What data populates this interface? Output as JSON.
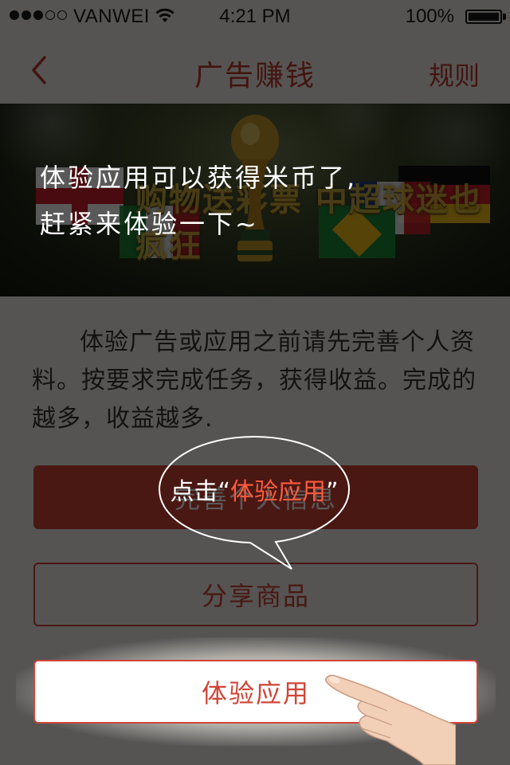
{
  "status_bar": {
    "carrier": "VANWEI",
    "time": "4:21 PM",
    "battery_percent": "100%",
    "battery_level": 1.0,
    "signal_icon": "signal-dots-icon",
    "wifi_icon": "wifi-icon"
  },
  "nav": {
    "title": "广告赚钱",
    "right_label": "规则",
    "back_icon": "chevron-left-icon"
  },
  "banner": {
    "slogan": "购物送彩票 中超球迷也疯狂"
  },
  "guide": {
    "line1": "体验应用可以获得米币了,",
    "line2": "赶紧来体验一下~",
    "bubble_prefix": "点击",
    "bubble_quote_open": "“",
    "bubble_highlight": "体验应用",
    "bubble_quote_close": "”"
  },
  "description": "体验广告或应用之前请先完善个人资料。按要求完成任务，获得收益。完成的越多，收益越多.",
  "buttons": {
    "complete_profile": "完善个人信息",
    "share_goods": "分享商品",
    "try_app": "体验应用"
  },
  "colors": {
    "accent": "#d04537",
    "overlay": "#000000",
    "highlight_text": "#ff5a3c"
  }
}
